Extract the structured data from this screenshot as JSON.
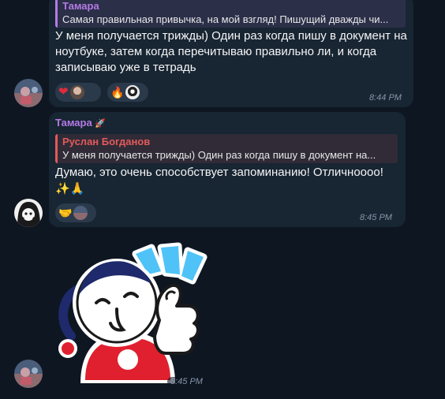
{
  "message1": {
    "reply": {
      "name": "Тамара",
      "text": "Самая правильная привычка, на мой взгляд! Пишущий дважды чи..."
    },
    "text": "У меня получается трижды) Один раз когда пишу в документ на ноутбуке, затем когда перечитываю правильно ли, и когда записываю уже в тетрадь",
    "time": "8:44 PM",
    "reactions": [
      {
        "emoji": "❤",
        "icon": "heart-icon"
      },
      {
        "emoji": "🔥",
        "icon": "fire-icon"
      }
    ]
  },
  "message2": {
    "sender": "Тамара",
    "reply": {
      "name": "Руслан Богданов",
      "text": "У меня получается трижды) Один раз когда пишу в документ на..."
    },
    "text": "Думаю, это очень способствует запоминанию! Отличноооо!",
    "emoji_line": "✨🙏",
    "time": "8:45 PM",
    "reactions": [
      {
        "emoji": "🤝",
        "icon": "handshake-icon"
      }
    ]
  },
  "sticker": {
    "time": "8:45 PM",
    "icon": "thumbs-up-sticker-icon"
  },
  "colors": {
    "background": "#0e1621",
    "bubble": "#182533",
    "reply_purple": "#b47be6",
    "reply_red": "#e25a5a",
    "time": "#8696a8"
  }
}
